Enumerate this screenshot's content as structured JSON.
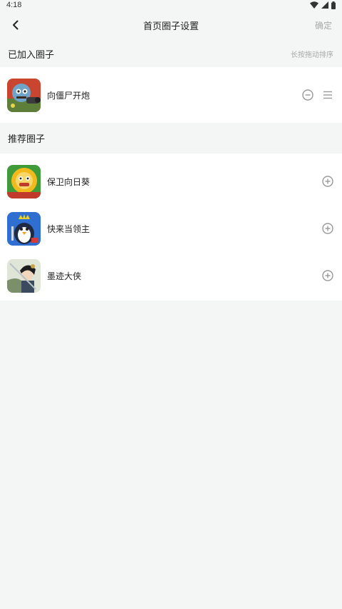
{
  "status_bar": {
    "time": "4:18",
    "icons": [
      "wifi-icon",
      "signal-icon",
      "battery-icon"
    ]
  },
  "header": {
    "title": "首页圈子设置",
    "confirm_label": "确定",
    "back_icon": "back-arrow-icon"
  },
  "joined": {
    "title": "已加入圈子",
    "hint": "长按拖动排序",
    "items": [
      {
        "name": "向僵尸开炮",
        "icon": "zombie-game-icon",
        "actions": [
          "remove-circle-icon",
          "drag-handle-icon"
        ]
      }
    ]
  },
  "recommended": {
    "title": "推荐圈子",
    "items": [
      {
        "name": "保卫向日葵",
        "icon": "sunflower-game-icon",
        "action": "add-circle-icon"
      },
      {
        "name": "快来当领主",
        "icon": "penguin-king-game-icon",
        "action": "add-circle-icon"
      },
      {
        "name": "墨迹大侠",
        "icon": "swordsman-game-icon",
        "action": "add-circle-icon"
      }
    ]
  },
  "colors": {
    "background": "#f4f6f6",
    "card": "#ffffff",
    "muted_text": "#a8a8a8",
    "icon_gray": "#9a9a9a"
  }
}
